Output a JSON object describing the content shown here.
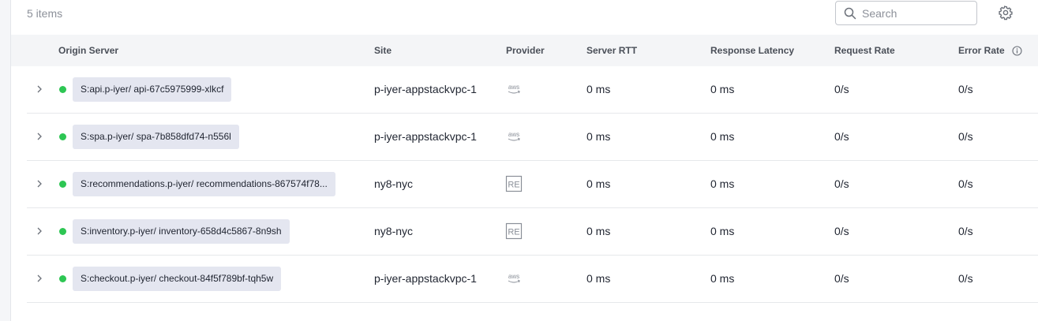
{
  "toolbar": {
    "item_count": "5 items",
    "search_placeholder": "Search"
  },
  "columns": {
    "origin_server": "Origin Server",
    "site": "Site",
    "provider": "Provider",
    "server_rtt": "Server RTT",
    "response_latency": "Response Latency",
    "request_rate": "Request Rate",
    "error_rate": "Error Rate"
  },
  "status_color": "#2dc653",
  "rows": [
    {
      "origin": "S:api.p-iyer/ api-67c5975999-xlkcf",
      "site": "p-iyer-appstackvpc-1",
      "provider": "aws",
      "server_rtt": "0 ms",
      "response_latency": "0 ms",
      "request_rate": "0/s",
      "error_rate": "0/s"
    },
    {
      "origin": "S:spa.p-iyer/ spa-7b858dfd74-n556l",
      "site": "p-iyer-appstackvpc-1",
      "provider": "aws",
      "server_rtt": "0 ms",
      "response_latency": "0 ms",
      "request_rate": "0/s",
      "error_rate": "0/s"
    },
    {
      "origin": "S:recommendations.p-iyer/ recommendations-867574f78...",
      "site": "ny8-nyc",
      "provider": "RE",
      "server_rtt": "0 ms",
      "response_latency": "0 ms",
      "request_rate": "0/s",
      "error_rate": "0/s"
    },
    {
      "origin": "S:inventory.p-iyer/ inventory-658d4c5867-8n9sh",
      "site": "ny8-nyc",
      "provider": "RE",
      "server_rtt": "0 ms",
      "response_latency": "0 ms",
      "request_rate": "0/s",
      "error_rate": "0/s"
    },
    {
      "origin": "S:checkout.p-iyer/ checkout-84f5f789bf-tqh5w",
      "site": "p-iyer-appstackvpc-1",
      "provider": "aws",
      "server_rtt": "0 ms",
      "response_latency": "0 ms",
      "request_rate": "0/s",
      "error_rate": "0/s"
    }
  ]
}
